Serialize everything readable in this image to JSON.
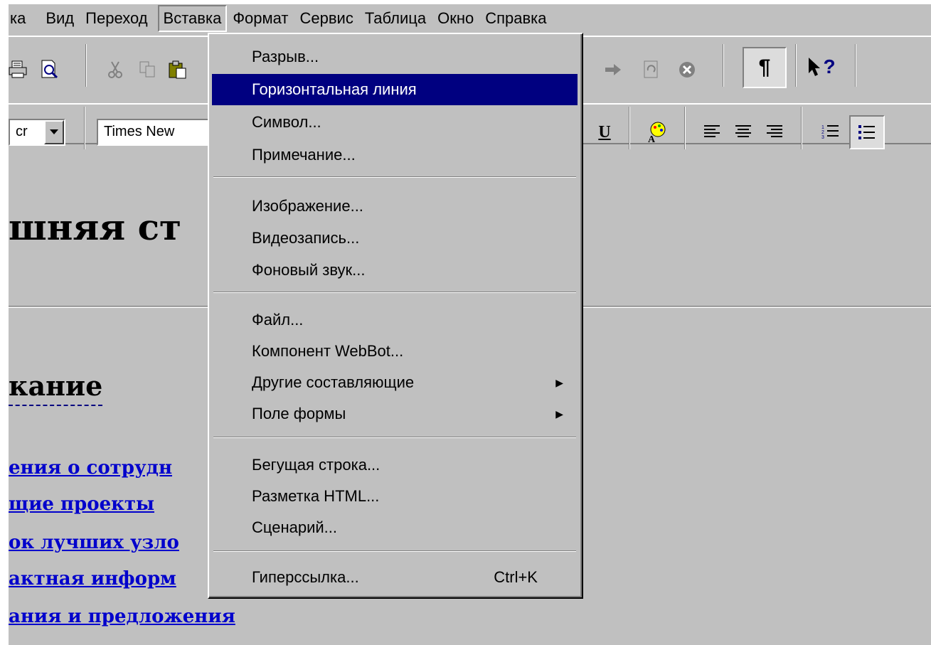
{
  "menubar": {
    "items": [
      {
        "label": "ка"
      },
      {
        "label": "Вид"
      },
      {
        "label": "Переход"
      },
      {
        "label": "Вставка"
      },
      {
        "label": "Формат"
      },
      {
        "label": "Сервис"
      },
      {
        "label": "Таблица"
      },
      {
        "label": "Окно"
      },
      {
        "label": "Справка"
      }
    ]
  },
  "toolbar": {
    "style_combo": "cr",
    "font_combo": "Times New",
    "underline_label": "U",
    "paragraph_label": "¶",
    "help_label": "?"
  },
  "document": {
    "heading": "шняя ст",
    "subheading": "кание",
    "links": [
      "ения о сотрудн",
      "щие проекты",
      "ок лучших узло",
      "актная информ",
      "ания и предложения"
    ]
  },
  "insert_menu": {
    "items": [
      {
        "label": "Разрыв..."
      },
      {
        "label": "Горизонтальная линия",
        "selected": true
      },
      {
        "label": "Символ..."
      },
      {
        "label": "Примечание..."
      },
      {
        "label": "Изображение..."
      },
      {
        "label": "Видеозапись..."
      },
      {
        "label": "Фоновый звук..."
      },
      {
        "label": "Файл..."
      },
      {
        "label": "Компонент WebBot..."
      },
      {
        "label": "Другие составляющие",
        "submenu": true
      },
      {
        "label": "Поле формы",
        "submenu": true
      },
      {
        "label": "Бегущая строка..."
      },
      {
        "label": "Разметка HTML..."
      },
      {
        "label": "Сценарий..."
      },
      {
        "label": "Гиперссылка...",
        "shortcut": "Ctrl+K"
      }
    ],
    "submenu_glyph": "▶"
  },
  "colors": {
    "face": "#c0c0c0",
    "highlight": "#000080",
    "link": "#0000cc"
  }
}
